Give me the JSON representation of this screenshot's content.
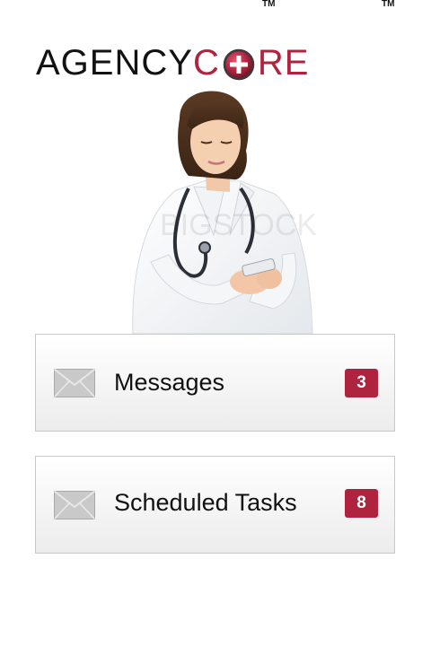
{
  "logo": {
    "part1": "AGENCY",
    "part2_c": "C",
    "part2_re": "RE",
    "trademark": "TM",
    "brand_color": "#b0233f"
  },
  "photo": {
    "watermark": "BIGSTOCK"
  },
  "menu": {
    "items": [
      {
        "label": "Messages",
        "badge": "3",
        "icon": "envelope-icon"
      },
      {
        "label": "Scheduled Tasks",
        "badge": "8",
        "icon": "envelope-icon"
      }
    ]
  }
}
